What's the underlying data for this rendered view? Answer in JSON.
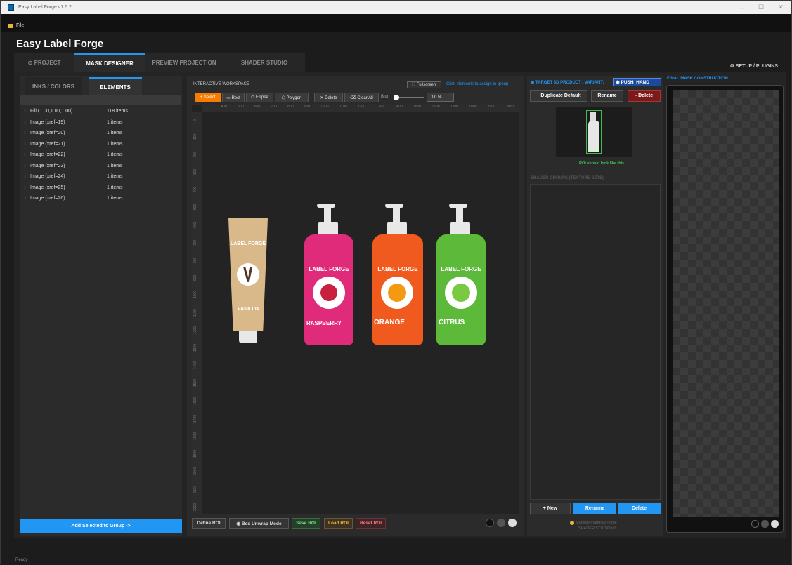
{
  "window": {
    "title": "Easy Label Forge v1.6.2",
    "minimize": "–",
    "maximize": "☐",
    "close": "✕"
  },
  "menu": {
    "file": "File"
  },
  "app_title": "Easy Label Forge",
  "tabs": [
    {
      "label": "⊙ PROJECT"
    },
    {
      "label": "MASK DESIGNER"
    },
    {
      "label": "PREVIEW PROJECTION"
    },
    {
      "label": "SHADER STUDIO"
    }
  ],
  "setup": "⚙ SETUP / PLUGINS",
  "left": {
    "tabs": [
      "INKS / COLORS",
      "ELEMENTS"
    ],
    "rows": [
      {
        "label": "Fill (1.00,1.00,1.00)",
        "count": "118 items"
      },
      {
        "label": "Image (xref=19)",
        "count": "1 items"
      },
      {
        "label": "Image (xref=20)",
        "count": "1 items"
      },
      {
        "label": "Image (xref=21)",
        "count": "1 items"
      },
      {
        "label": "Image (xref=22)",
        "count": "1 items"
      },
      {
        "label": "Image (xref=23)",
        "count": "1 items"
      },
      {
        "label": "Image (xref=24)",
        "count": "1 items"
      },
      {
        "label": "Image (xref=25)",
        "count": "1 items"
      },
      {
        "label": "Image (xref=26)",
        "count": "1 items"
      }
    ],
    "add_button": "Add Selected to Group ->"
  },
  "workspace": {
    "label": "INTERACTIVE WORKSPACE",
    "fullscreen": "⛶ Fullscreen",
    "hint": "Click elements to assign to group",
    "tools": {
      "select": "+ Select",
      "rect": "▭ Rect",
      "ellipse": "⬭ Ellipse",
      "polygon": "⬠ Polygon",
      "delete": "✕ Delete",
      "clear": "⌫ Clear All"
    },
    "blur_label": "Blur:",
    "blur_value": "0,0 %",
    "ruler_top": [
      "400",
      "500",
      "600",
      "700",
      "800",
      "900",
      "1000",
      "1100",
      "1200",
      "1300",
      "1400",
      "1500",
      "1600",
      "1700",
      "1800",
      "1900",
      "2000"
    ],
    "ruler_left": [
      "0",
      "100",
      "200",
      "300",
      "400",
      "500",
      "600",
      "700",
      "800",
      "900",
      "1000",
      "1100",
      "1200",
      "1300",
      "1400",
      "1500",
      "1600",
      "1700",
      "1800",
      "1900",
      "2000",
      "2100",
      "2200"
    ],
    "brand": "LABEL FORGE",
    "products": [
      "VANILLIA",
      "RASPBERRY",
      "ORANGE",
      "CITRUS"
    ],
    "bottom_buttons": {
      "define": "Define ROI",
      "box": "◉ Box Unwrap Mode",
      "save": "Save ROI",
      "load": "Load ROI",
      "reset": "Reset ROI"
    }
  },
  "target": {
    "label": "◉ TARGET 3D PRODUCT / VARIANT:",
    "variant": "◉ PUSH_HAND",
    "duplicate": "+ Duplicate Default",
    "rename": "Rename",
    "delete": "- Delete",
    "roi_hint": "ROI should look like this",
    "shader_groups": "SHADER GROUPS (TEXTURE SETS)",
    "new": "+ New",
    "rename2": "Rename",
    "delete2": "Delete",
    "manage_hint_1": "Manage materials in the",
    "manage_hint_2": "SHADER STUDIO tab."
  },
  "final": {
    "label": "FINAL MASK CONSTRUCTION"
  },
  "status": "Ready",
  "colors": {
    "accent": "#2196f3",
    "select": "#f57c00",
    "vanilla": "#d9b98a",
    "raspberry": "#e02a7a",
    "orange": "#f05a1e",
    "citrus": "#5cb93a"
  }
}
